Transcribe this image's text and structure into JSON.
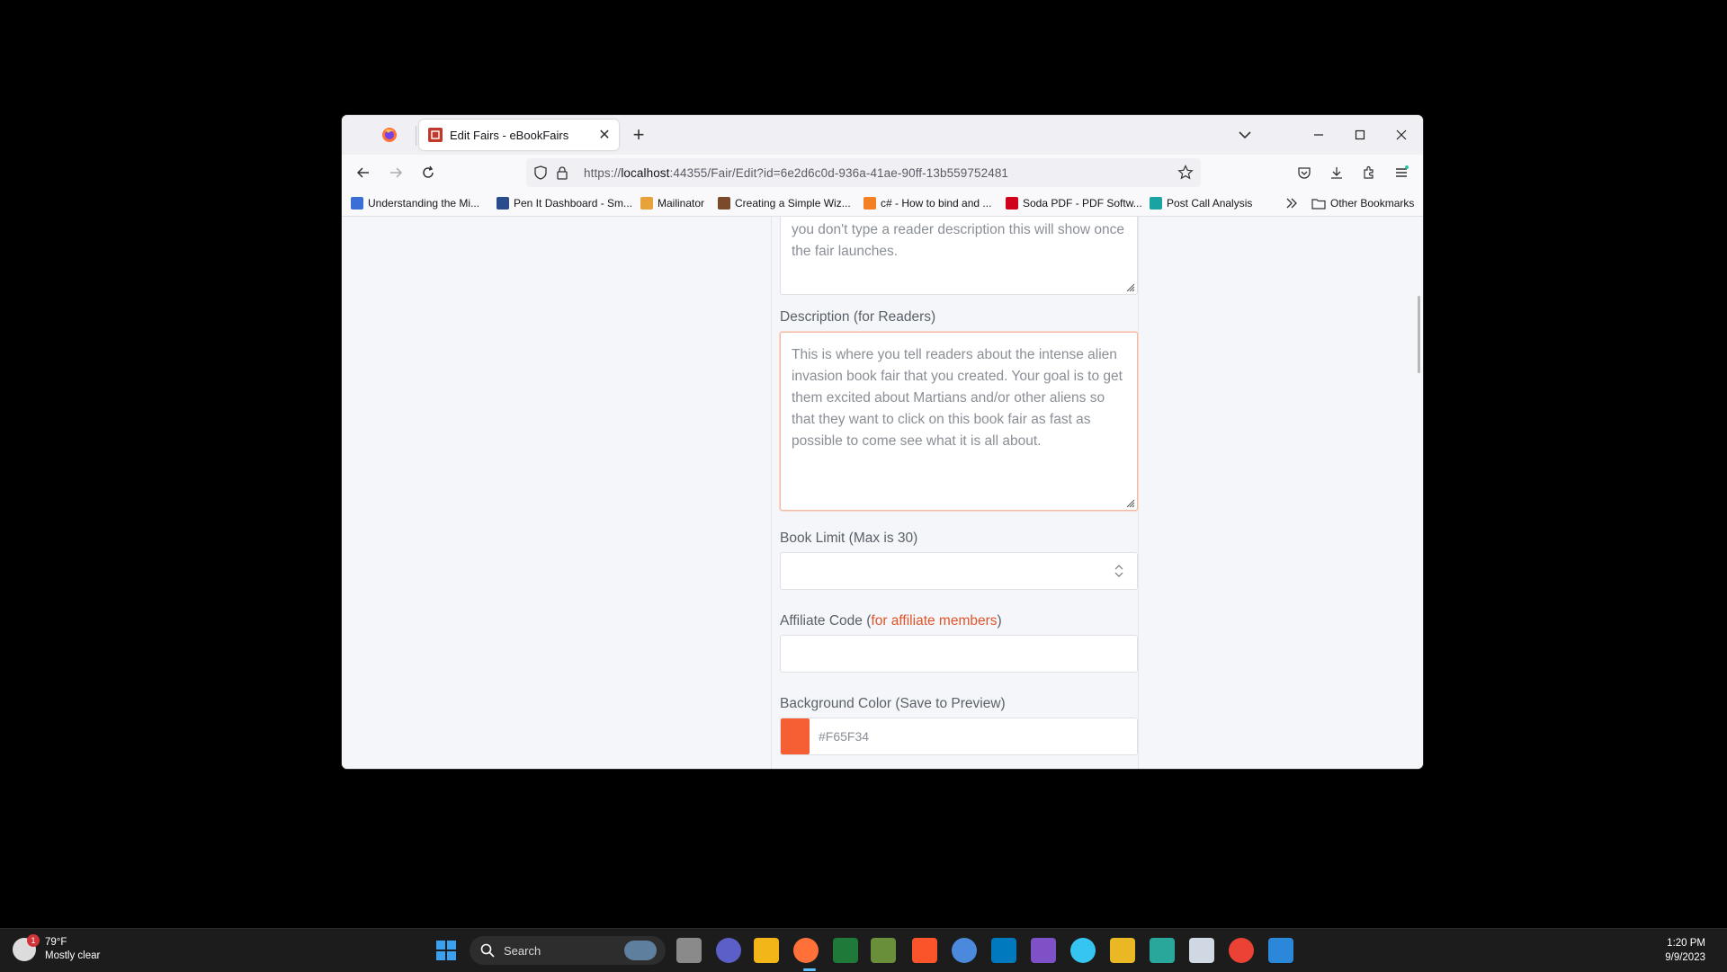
{
  "browser": {
    "active_tab": {
      "title": "Edit Fairs - eBookFairs"
    },
    "new_tab_label": "+",
    "url": {
      "scheme": "https://",
      "host": "localhost",
      "rest": ":44355/Fair/Edit?id=6e2d6c0d-936a-41ae-90ff-13b559752481"
    },
    "bookmarks": [
      {
        "label": "Understanding the Mi...",
        "color": "#3b6fd6"
      },
      {
        "label": "Pen It Dashboard - Sm...",
        "color": "#2b4c8c"
      },
      {
        "label": "Mailinator",
        "color": "#e8a23a"
      },
      {
        "label": "Creating a Simple Wiz...",
        "color": "#7a4a2a"
      },
      {
        "label": "c# - How to bind and ...",
        "color": "#f48024"
      },
      {
        "label": "Soda PDF - PDF Softw...",
        "color": "#d0021b"
      },
      {
        "label": "Post Call Analysis",
        "color": "#1aa3a3"
      }
    ],
    "other_bookmarks": "Other Bookmarks"
  },
  "form": {
    "reader_desc_placeholder_tail": "you don't type a reader description this will show once the fair launches.",
    "description_label": "Description (for Readers)",
    "description_placeholder": "This is where you tell readers about the intense alien invasion book fair that you created. Your goal is to get them excited about Martians and/or other aliens so that they want to click on this book fair as fast as possible to come see what it is all about.",
    "book_limit_label": "Book Limit (Max is 30)",
    "affiliate_label": "Affiliate Code (",
    "affiliate_accent": "for affiliate members",
    "affiliate_close": ")",
    "bg_color_label": "Background Color (Save to Preview)",
    "bg_color_value": "#F65F34",
    "bg_color_hex": "#F65F34"
  },
  "taskbar": {
    "weather_temp": "79°F",
    "weather_desc": "Mostly clear",
    "weather_badge": "1",
    "search_placeholder": "Search",
    "time": "1:20 PM",
    "date": "9/9/2023"
  }
}
